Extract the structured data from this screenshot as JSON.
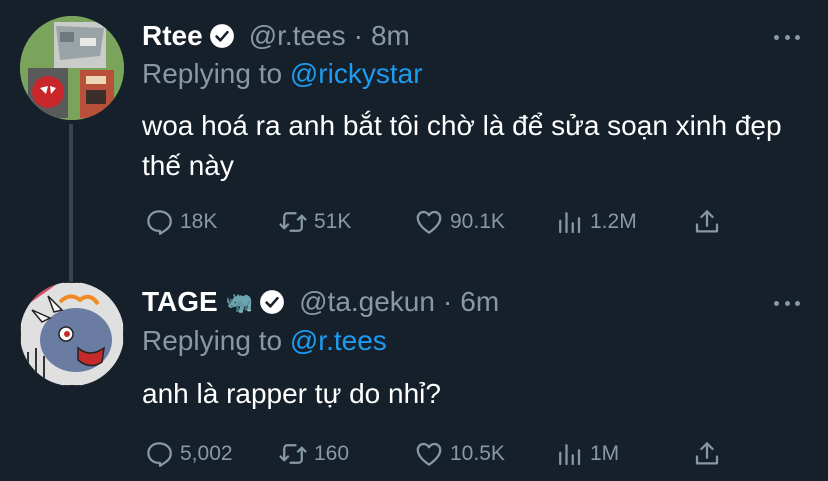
{
  "tweets": [
    {
      "name": "Rtee",
      "handle": "@r.tees",
      "separator": "·",
      "time": "8m",
      "replying_prefix": "Replying to ",
      "replying_to": "@rickystar",
      "text": "woa hoá ra anh bắt tôi chờ là để sửa soạn xinh đẹp thế này",
      "replies": "18K",
      "retweets": "51K",
      "likes": "90.1K",
      "views": "1.2M"
    },
    {
      "name": "TAGE",
      "emoji": "🦏",
      "handle": "@ta.gekun",
      "separator": "·",
      "time": "6m",
      "replying_prefix": "Replying to ",
      "replying_to": "@r.tees",
      "text": "anh là rapper tự do nhỉ?",
      "replies": "5,002",
      "retweets": "160",
      "likes": "10.5K",
      "views": "1M"
    }
  ],
  "colors": {
    "background": "#15202b",
    "text": "#ffffff",
    "secondary": "#8899a6",
    "link": "#1d9bf0"
  }
}
